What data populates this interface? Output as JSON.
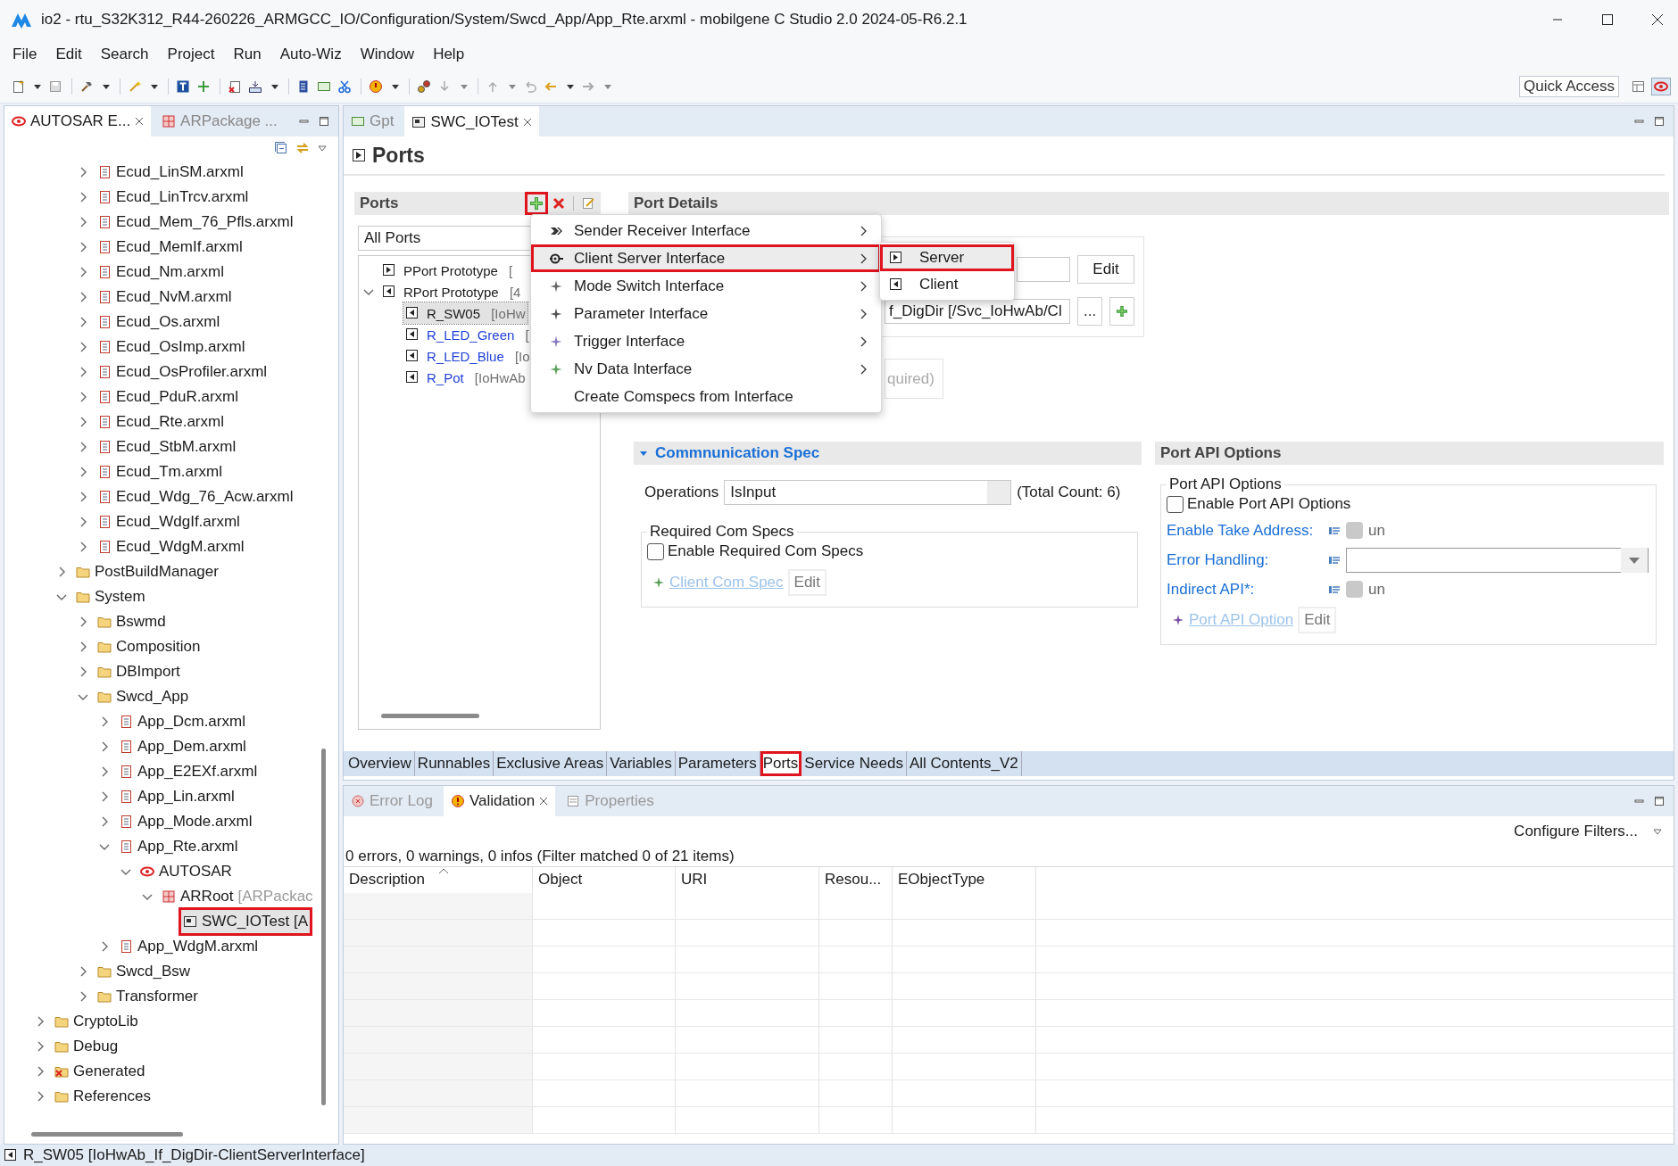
{
  "window": {
    "title": "io2 - rtu_S32K312_R44-260226_ARMGCC_IO/Configuration/System/Swcd_App/App_Rte.arxml - mobilgene C Studio 2.0 2024-05-R6.2.1"
  },
  "menu": [
    "File",
    "Edit",
    "Search",
    "Project",
    "Run",
    "Auto-Wiz",
    "Window",
    "Help"
  ],
  "toolbar": {
    "quick_access": {
      "placeholder": "Quick Access"
    }
  },
  "explorer": {
    "tabs": [
      {
        "label": "AUTOSAR E...",
        "selected": true,
        "kind": "autosar"
      },
      {
        "label": "ARPackage ...",
        "selected": false,
        "kind": "package"
      }
    ],
    "tree": [
      {
        "children": [
          {
            "children": [
              {
                "label": "Ecud_LinSM.arxml",
                "kind": "file",
                "expanded": false,
                "selected": false,
                "highlighted": false
              },
              {
                "label": "Ecud_LinTrcv.arxml",
                "kind": "file",
                "expanded": false,
                "selected": false,
                "highlighted": false
              },
              {
                "label": "Ecud_Mem_76_Pfls.arxml",
                "kind": "file",
                "expanded": false,
                "selected": false,
                "highlighted": false
              },
              {
                "label": "Ecud_MemIf.arxml",
                "kind": "file",
                "expanded": false,
                "selected": false,
                "highlighted": false
              },
              {
                "label": "Ecud_Nm.arxml",
                "kind": "file",
                "expanded": false,
                "selected": false,
                "highlighted": false
              },
              {
                "label": "Ecud_NvM.arxml",
                "kind": "file",
                "expanded": false,
                "selected": false,
                "highlighted": false
              },
              {
                "label": "Ecud_Os.arxml",
                "kind": "file",
                "expanded": false,
                "selected": false,
                "highlighted": false
              },
              {
                "label": "Ecud_OsImp.arxml",
                "kind": "file",
                "expanded": false,
                "selected": false,
                "highlighted": false
              },
              {
                "label": "Ecud_OsProfiler.arxml",
                "kind": "file",
                "expanded": false,
                "selected": false,
                "highlighted": false
              },
              {
                "label": "Ecud_PduR.arxml",
                "kind": "file",
                "expanded": false,
                "selected": false,
                "highlighted": false
              },
              {
                "label": "Ecud_Rte.arxml",
                "kind": "file",
                "expanded": false,
                "selected": false,
                "highlighted": false
              },
              {
                "label": "Ecud_StbM.arxml",
                "kind": "file",
                "expanded": false,
                "selected": false,
                "highlighted": false
              },
              {
                "label": "Ecud_Tm.arxml",
                "kind": "file",
                "expanded": false,
                "selected": false,
                "highlighted": false
              },
              {
                "label": "Ecud_Wdg_76_Acw.arxml",
                "kind": "file",
                "expanded": false,
                "selected": false,
                "highlighted": false
              },
              {
                "label": "Ecud_WdgIf.arxml",
                "kind": "file",
                "expanded": false,
                "selected": false,
                "highlighted": false
              },
              {
                "label": "Ecud_WdgM.arxml",
                "kind": "file",
                "expanded": false,
                "selected": false,
                "highlighted": false
              }
            ]
          },
          {
            "label": "PostBuildManager",
            "kind": "folder",
            "expanded": false,
            "selected": false,
            "highlighted": false
          },
          {
            "label": "System",
            "kind": "folder",
            "expanded": true,
            "selected": false,
            "highlighted": false,
            "children": [
              {
                "label": "Bswmd",
                "kind": "folder",
                "expanded": false,
                "selected": false,
                "highlighted": false
              },
              {
                "label": "Composition",
                "kind": "folder",
                "expanded": false,
                "selected": false,
                "highlighted": false
              },
              {
                "label": "DBImport",
                "kind": "folder",
                "expanded": false,
                "selected": false,
                "highlighted": false
              },
              {
                "label": "Swcd_App",
                "kind": "folder",
                "expanded": true,
                "selected": false,
                "highlighted": false,
                "children": [
                  {
                    "label": "App_Dcm.arxml",
                    "kind": "file",
                    "expanded": false,
                    "selected": false,
                    "highlighted": false
                  },
                  {
                    "label": "App_Dem.arxml",
                    "kind": "file",
                    "expanded": false,
                    "selected": false,
                    "highlighted": false
                  },
                  {
                    "label": "App_E2EXf.arxml",
                    "kind": "file",
                    "expanded": false,
                    "selected": false,
                    "highlighted": false
                  },
                  {
                    "label": "App_Lin.arxml",
                    "kind": "file",
                    "expanded": false,
                    "selected": false,
                    "highlighted": false
                  },
                  {
                    "label": "App_Mode.arxml",
                    "kind": "file",
                    "expanded": false,
                    "selected": false,
                    "highlighted": false
                  },
                  {
                    "label": "App_Rte.arxml",
                    "kind": "file",
                    "expanded": true,
                    "selected": false,
                    "highlighted": false,
                    "children": [
                      {
                        "label": "AUTOSAR",
                        "kind": "autosar",
                        "expanded": true,
                        "selected": false,
                        "highlighted": false,
                        "children": [
                          {
                            "label": "ARRoot",
                            "detail": "[ARPackac",
                            "kind": "package",
                            "expanded": true,
                            "selected": false,
                            "highlighted": false,
                            "children": [
                              {
                                "label": "SWC_IOTest [A",
                                "kind": "component",
                                "selected": true,
                                "highlighted": true
                              }
                            ]
                          }
                        ]
                      }
                    ]
                  },
                  {
                    "label": "App_WdgM.arxml",
                    "kind": "file",
                    "expanded": false,
                    "selected": false,
                    "highlighted": false
                  }
                ]
              },
              {
                "label": "Swcd_Bsw",
                "kind": "folder",
                "expanded": false,
                "selected": false,
                "highlighted": false
              },
              {
                "label": "Transformer",
                "kind": "folder",
                "expanded": false,
                "selected": false,
                "highlighted": false
              }
            ]
          }
        ]
      },
      {
        "label": "CryptoLib",
        "kind": "folder",
        "expanded": false,
        "selected": false,
        "highlighted": false
      },
      {
        "label": "Debug",
        "kind": "folder",
        "expanded": false,
        "selected": false,
        "highlighted": false
      },
      {
        "label": "Generated",
        "kind": "folder-error",
        "expanded": false,
        "selected": false,
        "highlighted": false
      },
      {
        "label": "References",
        "kind": "folder",
        "expanded": false,
        "selected": false,
        "highlighted": false
      }
    ]
  },
  "editor": {
    "tabs": [
      {
        "label": "Gpt",
        "selected": false,
        "kind": "gpt"
      },
      {
        "label": "SWC_IOTest",
        "selected": true,
        "kind": "component"
      }
    ],
    "title": "Ports",
    "ports": {
      "title": "Ports",
      "add_highlighted": true,
      "filter": "All Ports",
      "tree": [
        {
          "label": "PPort Prototype",
          "detail": "[",
          "kind": "provided",
          "selected": false,
          "color": "#1a1a1a"
        },
        {
          "label": "RPort Prototype",
          "detail": "[4",
          "kind": "required",
          "expanded": true,
          "selected": false,
          "color": "#1a1a1a",
          "children": [
            {
              "label": "R_SW05",
              "detail": "[IoHw",
              "kind": "required",
              "selected": true,
              "color": "#1a1a1a"
            },
            {
              "label": "R_LED_Green",
              "detail": "[",
              "kind": "required",
              "selected": false,
              "color": "#1f3fd8"
            },
            {
              "label": "R_LED_Blue",
              "detail": "[Io",
              "kind": "required",
              "selected": false,
              "color": "#1f3fd8"
            },
            {
              "label": "R_Pot",
              "detail": "[IoHwAb",
              "kind": "required",
              "selected": false,
              "color": "#1f3fd8"
            }
          ]
        }
      ]
    },
    "port_details": {
      "title": "Port Details",
      "edit": "Edit",
      "interface": "f_DigDir [/Svc_IoHwAb/Cl",
      "browse": "...",
      "kind_fragment": "quired)"
    },
    "communication_spec": {
      "title": "Commnunication Spec",
      "expanded": true,
      "operations_label": "Operations",
      "operation": "IsInput",
      "total": "(Total Count: 6)",
      "group": "Required Com Specs",
      "enable": {
        "label": "Enable Required Com Specs",
        "checked": false
      },
      "link": "Client Com Spec",
      "edit": "Edit"
    },
    "port_api_options": {
      "title": "Port API Options",
      "group": "Port API Options",
      "enable": {
        "label": "Enable Port API Options",
        "checked": false
      },
      "rows": [
        {
          "kind": "toggle",
          "label": "Enable Take Address:",
          "value": "un"
        },
        {
          "kind": "combo",
          "label": "Error Handling:"
        },
        {
          "kind": "toggle",
          "label": "Indirect API*:",
          "value": "un"
        }
      ],
      "link": "Port API Option",
      "edit": "Edit"
    },
    "page_tabs": [
      {
        "label": "Overview",
        "selected": false,
        "highlighted": false
      },
      {
        "label": "Runnables",
        "selected": false,
        "highlighted": false
      },
      {
        "label": "Exclusive Areas",
        "selected": false,
        "highlighted": false
      },
      {
        "label": "Variables",
        "selected": false,
        "highlighted": false
      },
      {
        "label": "Parameters",
        "selected": false,
        "highlighted": false
      },
      {
        "label": "Ports",
        "selected": true,
        "highlighted": true
      },
      {
        "label": "Service Needs",
        "selected": false,
        "highlighted": false
      },
      {
        "label": "All Contents_V2",
        "selected": false,
        "highlighted": false
      }
    ]
  },
  "context_menu": {
    "items": [
      {
        "label": "Sender Receiver Interface",
        "kind": "sender-receiver",
        "submenu": true,
        "active": false,
        "highlighted": false
      },
      {
        "label": "Client Server Interface",
        "kind": "client-server",
        "submenu": true,
        "active": true,
        "highlighted": true
      },
      {
        "label": "Mode Switch Interface",
        "kind": "mode",
        "submenu": true,
        "active": false,
        "highlighted": false
      },
      {
        "label": "Parameter Interface",
        "kind": "parameter",
        "submenu": true,
        "active": false,
        "highlighted": false
      },
      {
        "label": "Trigger Interface",
        "kind": "trigger",
        "submenu": true,
        "active": false,
        "highlighted": false
      },
      {
        "label": "Nv Data Interface",
        "kind": "nvdata",
        "submenu": true,
        "active": false,
        "highlighted": false
      },
      {
        "label": "Create Comspecs from Interface",
        "submenu": false,
        "active": false,
        "highlighted": false
      }
    ],
    "submenu": [
      {
        "label": "Server",
        "kind": "provided",
        "active": true,
        "highlighted": true
      },
      {
        "label": "Client",
        "kind": "required",
        "active": false,
        "highlighted": false
      }
    ]
  },
  "validation": {
    "tabs": [
      {
        "label": "Error Log",
        "selected": false,
        "kind": "error-log"
      },
      {
        "label": "Validation",
        "selected": true,
        "kind": "warning"
      },
      {
        "label": "Properties",
        "selected": false,
        "kind": "properties"
      }
    ],
    "configure": "Configure Filters...",
    "summary": "0 errors, 0 warnings, 0 infos (Filter matched 0 of 21 items)",
    "columns": [
      {
        "label": "Description",
        "sorted": true
      },
      {
        "label": "Object",
        "sorted": false
      },
      {
        "label": "URI",
        "sorted": false
      },
      {
        "label": "Resou...",
        "sorted": false
      },
      {
        "label": "EObjectType",
        "sorted": false
      }
    ]
  },
  "status_bar": {
    "text": "R_SW05 [IoHwAb_If_DigDir-ClientServerInterface]"
  }
}
